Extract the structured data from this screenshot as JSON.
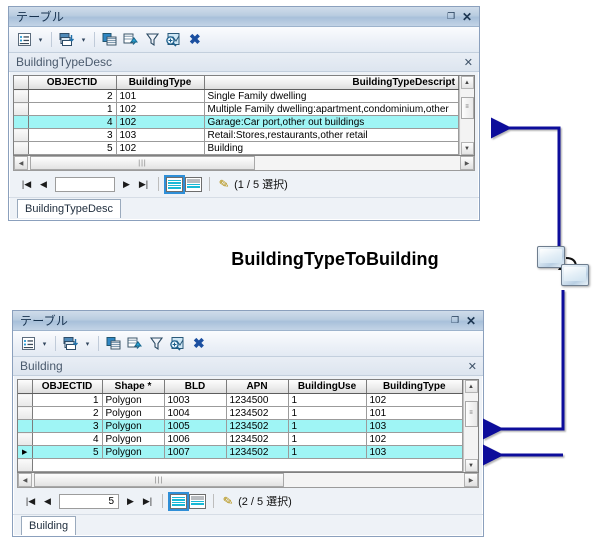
{
  "window_title": "テーブル",
  "relationship_label": "BuildingTypeToBuilding",
  "window_controls": {
    "maximize": "❐",
    "close": "✕"
  },
  "toolbar": {
    "options_icon": "table-options-icon",
    "related_tables_icon": "related-tables-icon",
    "move_field_icon": "move-field-icon",
    "select_by_attributes_icon": "select-by-attributes-icon",
    "clear_selection_icon": "clear-selection-icon",
    "zoom_to_selected_icon": "zoom-to-selected-icon",
    "delete_icon": "✖",
    "caret": "▾"
  },
  "nav": {
    "first": "|◀",
    "prev": "◀",
    "next": "▶",
    "last": "▶|",
    "pencil_icon": "edit-pencil-icon"
  },
  "tables": [
    {
      "panel_name": "BuildingTypeDesc",
      "tab_label": "BuildingTypeDesc",
      "close_x": "✕",
      "record_value": "",
      "selection_text": "(1 / 5 選択)",
      "columns": [
        "OBJECTID",
        "BuildingType",
        "BuildingTypeDescript"
      ],
      "rows": [
        {
          "objectid": "2",
          "buildingtype": "101",
          "description": "Single Family dwelling",
          "selected": false
        },
        {
          "objectid": "1",
          "buildingtype": "102",
          "description": "Multiple Family dwelling:apartment,condominium,other",
          "selected": false
        },
        {
          "objectid": "4",
          "buildingtype": "102",
          "description": "Garage:Car port,other out buildings",
          "selected": true
        },
        {
          "objectid": "3",
          "buildingtype": "103",
          "description": "Retail:Stores,restaurants,other retail",
          "selected": false
        },
        {
          "objectid": "5",
          "buildingtype": "102",
          "description": "Building",
          "selected": false
        }
      ]
    },
    {
      "panel_name": "Building",
      "tab_label": "Building",
      "close_x": "✕",
      "record_value": "5",
      "selection_text": "(2 / 5 選択)",
      "columns": [
        "OBJECTID",
        "Shape *",
        "BLD",
        "APN",
        "BuildingUse",
        "BuildingType"
      ],
      "rows": [
        {
          "objectid": "1",
          "shape": "Polygon",
          "bld": "1003",
          "apn": "1234500",
          "buildinguse": "1",
          "buildingtype": "102",
          "selected": false,
          "current": false
        },
        {
          "objectid": "2",
          "shape": "Polygon",
          "bld": "1004",
          "apn": "1234502",
          "buildinguse": "1",
          "buildingtype": "101",
          "selected": false,
          "current": false
        },
        {
          "objectid": "3",
          "shape": "Polygon",
          "bld": "1005",
          "apn": "1234502",
          "buildinguse": "1",
          "buildingtype": "103",
          "selected": true,
          "current": false
        },
        {
          "objectid": "4",
          "shape": "Polygon",
          "bld": "1006",
          "apn": "1234502",
          "buildinguse": "1",
          "buildingtype": "102",
          "selected": false,
          "current": false
        },
        {
          "objectid": "5",
          "shape": "Polygon",
          "bld": "1007",
          "apn": "1234502",
          "buildinguse": "1",
          "buildingtype": "103",
          "selected": true,
          "current": true
        }
      ]
    }
  ],
  "colors": {
    "selection_highlight": "#9ff5f5",
    "arrow": "#0f0f9b",
    "titlebar": "#b9cce0"
  }
}
